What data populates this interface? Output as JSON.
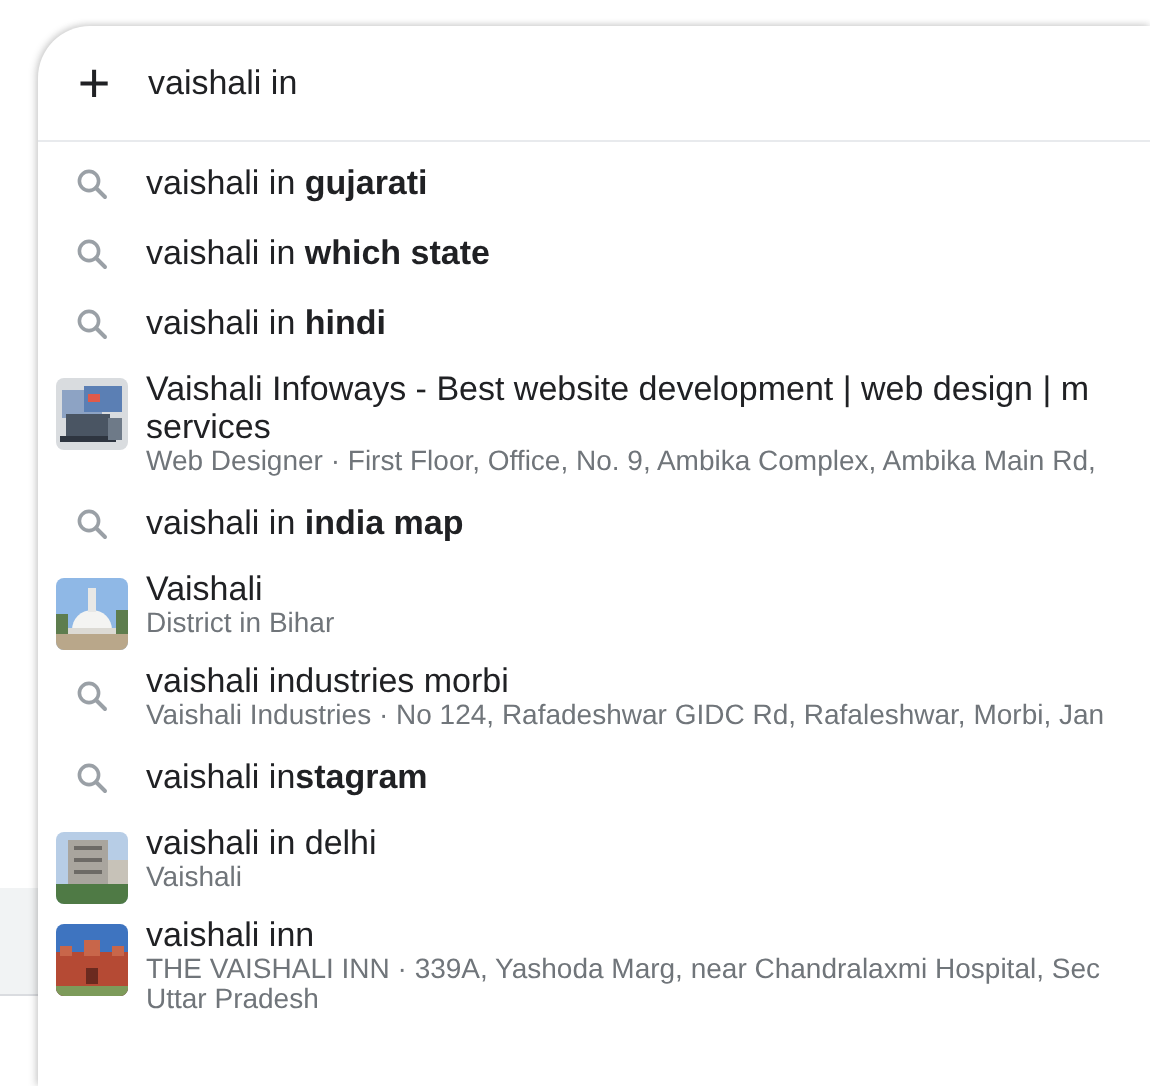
{
  "search": {
    "add_icon": "+",
    "value": "vaishali in"
  },
  "suggestions": [
    {
      "kind": "query",
      "lines": [
        "vaishali in **gujarati**"
      ]
    },
    {
      "kind": "query",
      "lines": [
        "vaishali in **which state**"
      ]
    },
    {
      "kind": "query",
      "lines": [
        "vaishali in **hindi**"
      ]
    },
    {
      "kind": "entity",
      "lines": [
        "Vaishali Infoways - Best website development | web design | m",
        "services"
      ],
      "details": [
        "Web Designer · First Floor, Office, No. 9, Ambika Complex, Ambika Main Rd,"
      ]
    },
    {
      "kind": "query",
      "lines": [
        "vaishali in **india map**"
      ]
    },
    {
      "kind": "entity",
      "lines": [
        "Vaishali"
      ],
      "details": [
        "District in Bihar"
      ]
    },
    {
      "kind": "query",
      "lines": [
        "vaishali industries morbi"
      ],
      "details": [
        "Vaishali Industries · No 124, Rafadeshwar GIDC Rd, Rafaleshwar, Morbi, Jan"
      ]
    },
    {
      "kind": "query",
      "lines": [
        "vaishali in**stagram**"
      ]
    },
    {
      "kind": "entity",
      "lines": [
        "vaishali in delhi"
      ],
      "details": [
        "Vaishali"
      ]
    },
    {
      "kind": "entity",
      "lines": [
        "vaishali inn"
      ],
      "details": [
        "THE VAISHALI INN · 339A, Yashoda Marg, near Chandralaxmi Hospital, Sec",
        "Uttar Pradesh"
      ]
    }
  ]
}
